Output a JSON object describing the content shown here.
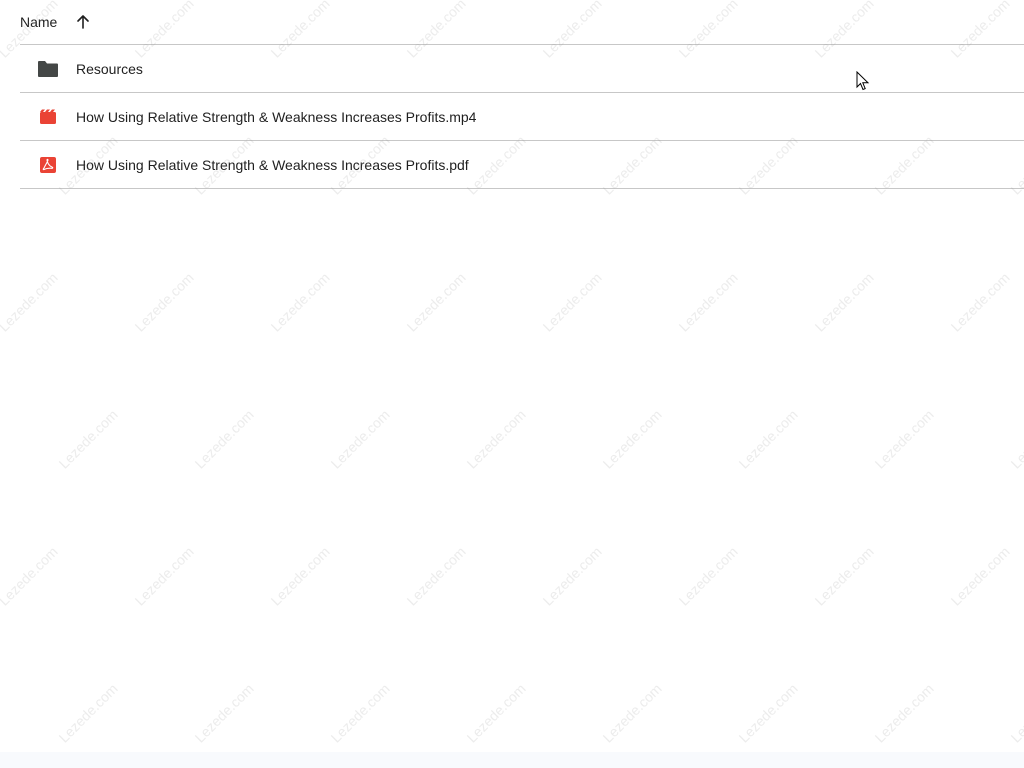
{
  "header": {
    "name_label": "Name",
    "sort_icon": "arrow-up-icon"
  },
  "rows": [
    {
      "label": "Resources",
      "icon": "folder-icon",
      "icon_color": "#444746"
    },
    {
      "label": "How Using Relative Strength & Weakness Increases Profits.mp4",
      "icon": "video-file-icon",
      "icon_color": "#ea4335"
    },
    {
      "label": "How Using Relative Strength & Weakness Increases Profits.pdf",
      "icon": "pdf-file-icon",
      "icon_color": "#ea4335"
    }
  ],
  "watermark": {
    "text": "Lezede.com"
  }
}
